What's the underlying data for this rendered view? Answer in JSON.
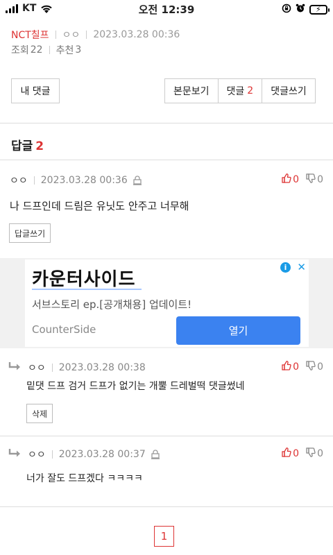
{
  "status_bar": {
    "carrier": "KT",
    "time": "오전 12:39"
  },
  "post": {
    "category": "NCT칠프",
    "author": "ㅇㅇ",
    "date": "2023.03.28 00:36",
    "views_label": "조회",
    "views": "22",
    "recommend_label": "추천",
    "recommend": "3"
  },
  "toolbar": {
    "my_comments": "내 댓글",
    "view_post": "본문보기",
    "comments_label": "댓글",
    "comments_count": "2",
    "write_comment": "댓글쓰기"
  },
  "replies": {
    "label": "답글",
    "count": "2"
  },
  "comments": [
    {
      "author": "ㅇㅇ",
      "date": "2023.03.28 00:36",
      "text": "나 드프인데 드림은 유닛도 안주고 너무해",
      "up": "0",
      "down": "0",
      "action": "답글쓰기"
    },
    {
      "author": "ㅇㅇ",
      "date": "2023.03.28 00:38",
      "text": "밑댓 드프 검거 드프가 없기는 개뿔 드레벌떡 댓글썼네",
      "up": "0",
      "down": "0",
      "action": "삭제"
    },
    {
      "author": "ㅇㅇ",
      "date": "2023.03.28 00:37",
      "text": "너가 잘도 드프겠다 ㅋㅋㅋㅋ",
      "up": "0",
      "down": "0"
    }
  ],
  "ad": {
    "title": "카운터사이드",
    "description": "서브스토리 ep.[공개채용] 업데이트!",
    "brand": "CounterSide",
    "cta": "열기",
    "info": "i",
    "close": "✕"
  },
  "pagination": {
    "current": "1"
  },
  "colors": {
    "accent_red": "#d33333",
    "ad_button_blue": "#3b82f0"
  }
}
